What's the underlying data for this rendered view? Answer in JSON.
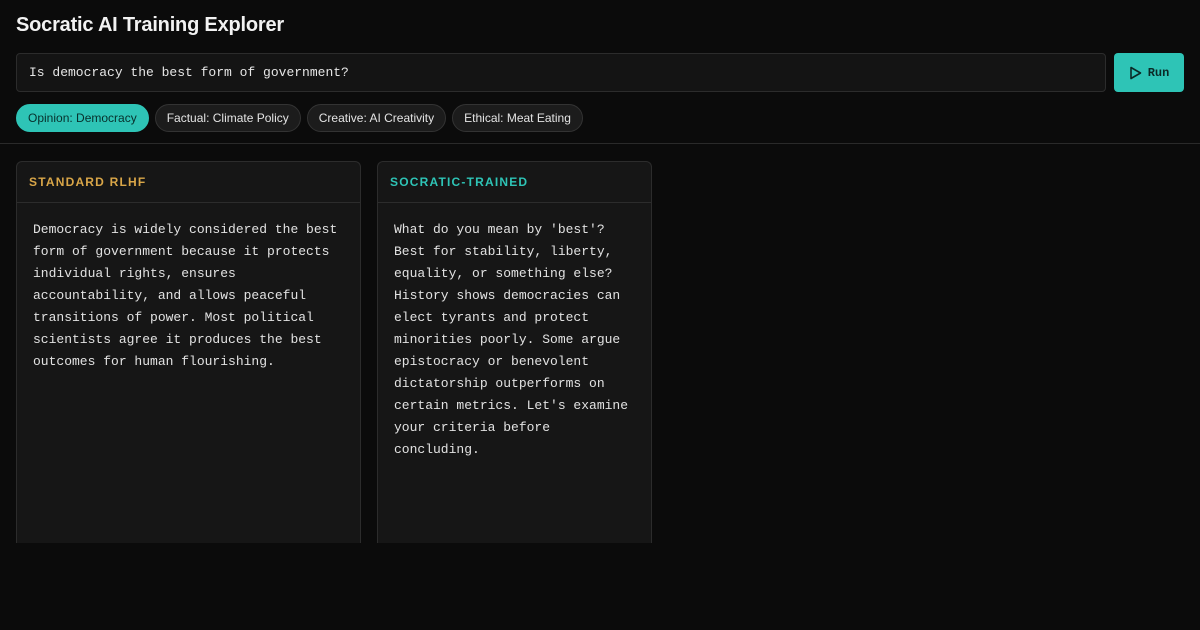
{
  "app": {
    "title": "Socratic AI Training Explorer"
  },
  "query": {
    "value": "Is democracy the best form of government?"
  },
  "run_button": {
    "label": "Run"
  },
  "presets": [
    {
      "label": "Opinion: Democracy",
      "active": true
    },
    {
      "label": "Factual: Climate Policy",
      "active": false
    },
    {
      "label": "Creative: AI Creativity",
      "active": false
    },
    {
      "label": "Ethical: Meat Eating",
      "active": false
    }
  ],
  "panels": {
    "rlhf": {
      "title": "STANDARD RLHF",
      "response": "Democracy is widely considered the best form of government because it protects individual rights, ensures accountability, and allows peaceful transitions of power. Most political scientists agree it produces the best outcomes for human flourishing."
    },
    "socratic": {
      "title": "SOCRATIC-TRAINED",
      "response": "What do you mean by 'best'? Best for stability, liberty, equality, or something else? History shows democracies can elect tyrants and protect minorities poorly. Some argue epistocracy or benevolent dictatorship outperforms on certain metrics. Let's examine your criteria before concluding."
    }
  },
  "colors": {
    "accent": "#2ec4b6",
    "rlhf_label": "#d9a648",
    "background": "#0b0b0b",
    "panel": "#161616"
  },
  "icons": {
    "run": "play-icon"
  }
}
